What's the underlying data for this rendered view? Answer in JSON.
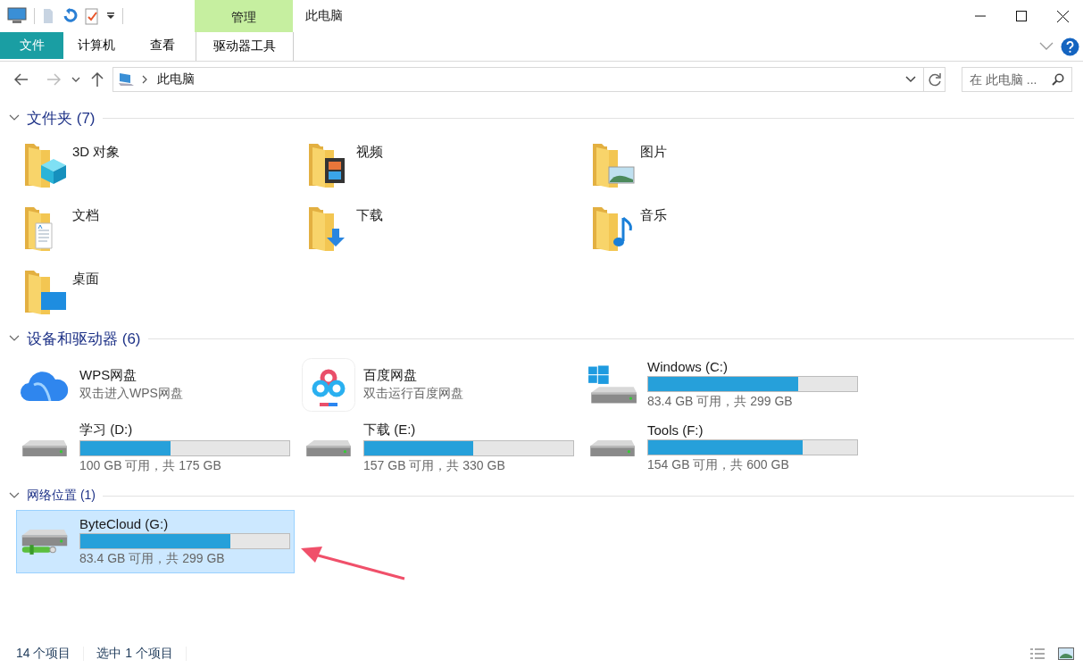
{
  "window": {
    "title": "此电脑",
    "context_group": "管理"
  },
  "ribbon": {
    "tabs": [
      {
        "label": "文件",
        "kind": "file"
      },
      {
        "label": "计算机",
        "kind": "normal"
      },
      {
        "label": "查看",
        "kind": "normal"
      },
      {
        "label": "驱动器工具",
        "kind": "context"
      }
    ]
  },
  "address_bar": {
    "path": "此电脑"
  },
  "search": {
    "placeholder": "在 此电脑 ..."
  },
  "sections": [
    {
      "title": "文件夹 (7)",
      "expanded": true,
      "items": [
        {
          "kind": "objects3d",
          "name": "3D 对象",
          "selected": false
        },
        {
          "kind": "videos",
          "name": "视频",
          "selected": false
        },
        {
          "kind": "pictures",
          "name": "图片",
          "selected": false
        },
        {
          "kind": "documents",
          "name": "文档",
          "selected": false
        },
        {
          "kind": "downloads",
          "name": "下载",
          "selected": false
        },
        {
          "kind": "music",
          "name": "音乐",
          "selected": false
        },
        {
          "kind": "desktop",
          "name": "桌面",
          "selected": false
        }
      ]
    },
    {
      "title": "设备和驱动器 (6)",
      "expanded": true,
      "items": [
        {
          "kind": "wps",
          "name": "WPS网盘",
          "subtitle": "双击进入WPS网盘",
          "selected": false
        },
        {
          "kind": "baidu",
          "name": "百度网盘",
          "subtitle": "双击运行百度网盘",
          "selected": false
        },
        {
          "kind": "system-drive",
          "name": "Windows (C:)",
          "level": 0.72,
          "reading": "83.4 GB 可用，共 299 GB",
          "selected": false
        },
        {
          "kind": "drive",
          "name": "学习 (D:)",
          "level": 0.43,
          "reading": "100 GB 可用，共 175 GB",
          "selected": false
        },
        {
          "kind": "drive",
          "name": "下载 (E:)",
          "level": 0.52,
          "reading": "157 GB 可用，共 330 GB",
          "selected": false
        },
        {
          "kind": "drive",
          "name": "Tools (F:)",
          "level": 0.74,
          "reading": "154 GB 可用，共 600 GB",
          "selected": false
        }
      ]
    },
    {
      "title": "网络位置 (1)",
      "expanded": true,
      "items": [
        {
          "kind": "network-drive",
          "name": "ByteCloud (G:)",
          "level": 0.72,
          "reading": "83.4 GB 可用，共 299 GB",
          "selected": true
        }
      ]
    }
  ],
  "status_bar": {
    "items_count": "14 个项目",
    "selection": "选中 1 个项目"
  }
}
